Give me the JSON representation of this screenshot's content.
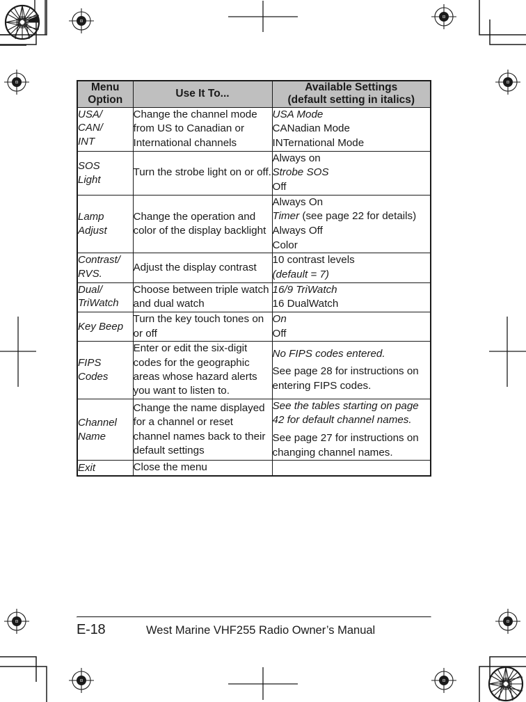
{
  "table": {
    "headers": [
      "Menu Option",
      "Use It To...",
      "Available Settings (default setting in italics)"
    ],
    "header_lines": {
      "col1_line1": "Menu",
      "col1_line2": "Option",
      "col2_line1": "Use It To...",
      "col3_line1": "Available Settings",
      "col3_line2": "(default setting in italics)"
    },
    "rows": [
      {
        "option_lines": [
          "USA/",
          "CAN/",
          "INT"
        ],
        "use": "Change the channel mode from US to Canadian or International channels",
        "settings_lines": [
          "USA Mode",
          "CANadian Mode",
          "INTernational Mode"
        ],
        "settings_italic": [
          true,
          false,
          false
        ]
      },
      {
        "option_lines": [
          "SOS",
          "Light"
        ],
        "use": "Turn the strobe light on or off.",
        "settings_lines": [
          "Always on",
          "Strobe SOS",
          "Off"
        ],
        "settings_italic": [
          false,
          true,
          false
        ]
      },
      {
        "option_lines": [
          "Lamp",
          "Adjust"
        ],
        "use": "Change the operation and color of the display backlight",
        "settings_lines": [
          "Always On",
          "Timer (see page 22 for details)",
          "Always Off",
          "Color"
        ],
        "settings_italic": [
          false,
          "mixed",
          false,
          false
        ],
        "settings_mixed": {
          "italic_part": "Timer",
          "roman_part": " (see page 22 for details)"
        }
      },
      {
        "option_lines": [
          "Contrast/",
          "RVS."
        ],
        "use": "Adjust the display contrast",
        "settings_lines": [
          "10 contrast levels",
          "(default = 7)"
        ],
        "settings_italic": [
          false,
          true
        ]
      },
      {
        "option_lines": [
          "Dual/",
          "TriWatch"
        ],
        "use": "Choose between triple watch and dual watch",
        "settings_lines": [
          "16/9 TriWatch",
          "16 DualWatch"
        ],
        "settings_italic": [
          true,
          false
        ]
      },
      {
        "option_lines": [
          "Key Beep"
        ],
        "use": "Turn the key touch tones on or off",
        "settings_lines": [
          "On",
          "Off"
        ],
        "settings_italic": [
          true,
          false
        ]
      },
      {
        "option_lines": [
          "FIPS",
          "Codes"
        ],
        "use": "Enter or edit the six-digit codes for the geographic areas whose hazard alerts you want to listen to.",
        "settings_paragraphs": [
          "No FIPS codes entered.",
          "See page 28 for instructions on entering FIPS codes."
        ],
        "settings_para_italic": [
          true,
          false
        ]
      },
      {
        "option_lines": [
          "Channel",
          "Name"
        ],
        "use": "Change the name displayed for a channel or reset channel names back to their default settings",
        "settings_paragraphs": [
          "See the tables starting on page 42 for default channel names.",
          "See page 27 for instructions on changing channel names."
        ],
        "settings_para_italic": [
          true,
          false
        ]
      },
      {
        "option_lines": [
          "Exit"
        ],
        "use": "Close the menu",
        "settings_lines": [],
        "settings_italic": []
      }
    ]
  },
  "footer": {
    "folio": "E-18",
    "manual_title": "West Marine VHF255 Radio Owner’s Manual"
  },
  "colors": {
    "header_fill": "#bfbfbf",
    "rule": "#1a1a1a",
    "text": "#1a1a1a",
    "page_background": "#ffffff"
  }
}
